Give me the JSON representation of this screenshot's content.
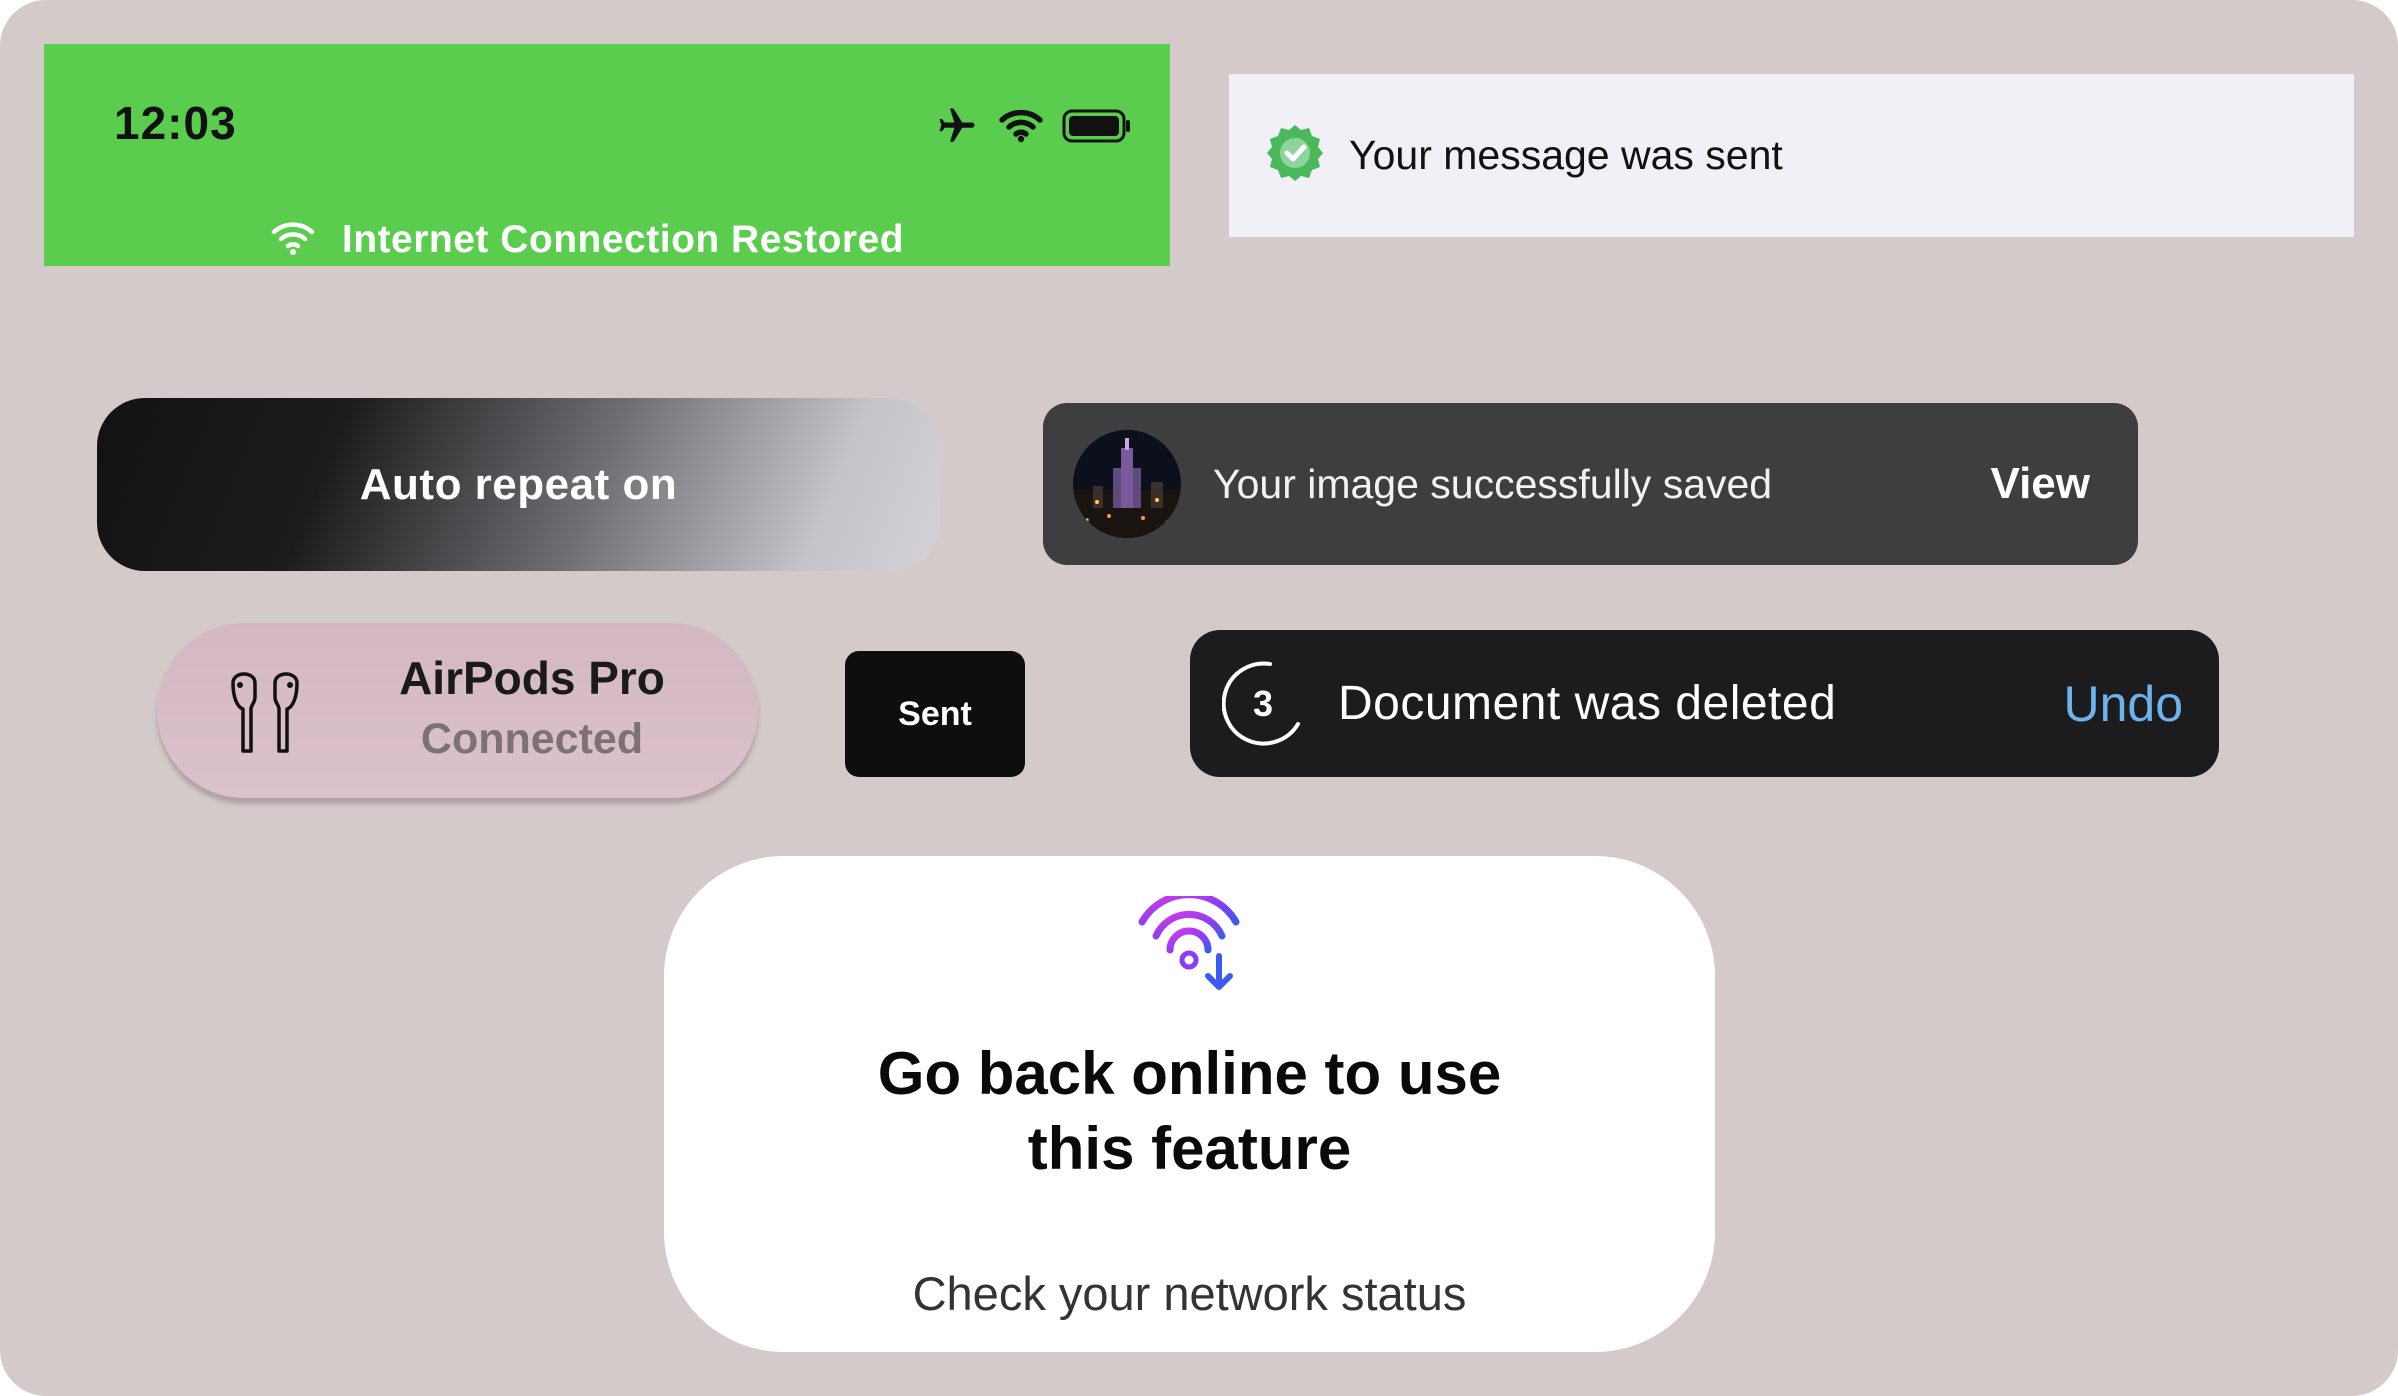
{
  "status_bar": {
    "time": "12:03",
    "icons": [
      "airplane-icon",
      "wifi-icon",
      "battery-icon"
    ],
    "restored_text": "Internet Connection Restored",
    "background": "#5acd4f"
  },
  "message_banner": {
    "icon": "verified-badge-icon",
    "text": "Your message was sent",
    "badge_color": "#4cb85c"
  },
  "auto_repeat": {
    "text": "Auto repeat on"
  },
  "image_saved": {
    "thumbnail": "city-night-thumbnail",
    "text": "Your image successfully saved",
    "action_label": "View"
  },
  "airpods": {
    "icon": "airpods-icon",
    "title": "AirPods Pro",
    "subtitle": "Connected"
  },
  "sent": {
    "label": "Sent"
  },
  "document_deleted": {
    "countdown": "3",
    "text": "Document was deleted",
    "action_label": "Undo",
    "action_color": "#6fb3ec"
  },
  "offline_card": {
    "icon": "wifi-download-icon",
    "title_line1": "Go back online to use",
    "title_line2": "this feature",
    "subtitle": "Check your network status"
  }
}
